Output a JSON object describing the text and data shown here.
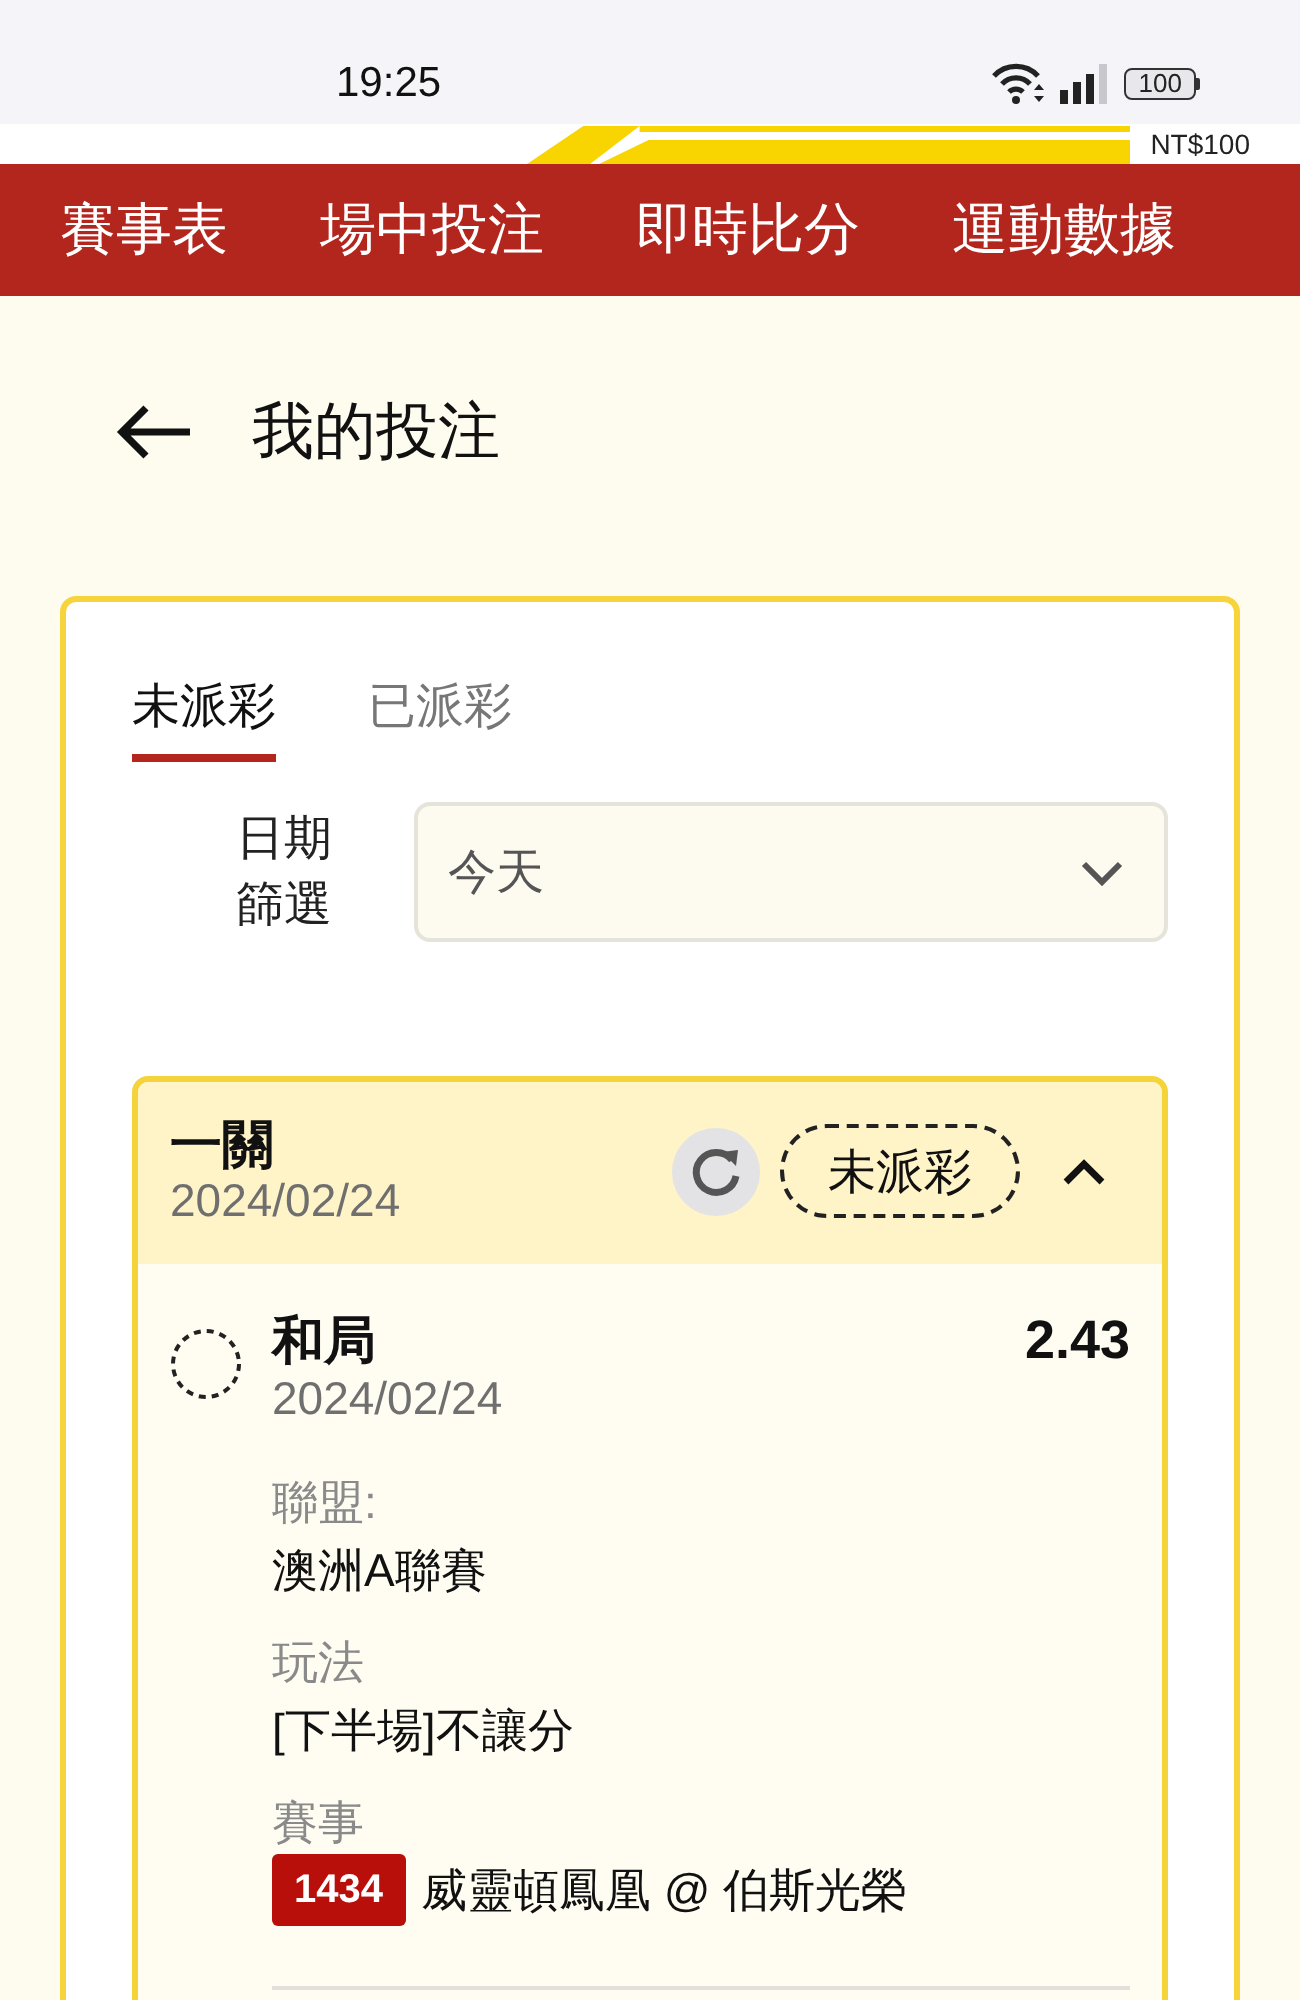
{
  "status_bar": {
    "time": "19:25",
    "battery": "100"
  },
  "balance": "NT$100",
  "nav": [
    "賽事表",
    "場中投注",
    "即時比分",
    "運動數據"
  ],
  "page": {
    "title": "我的投注"
  },
  "tabs": [
    {
      "label": "未派彩",
      "selected": true
    },
    {
      "label": "已派彩",
      "selected": false
    }
  ],
  "date_filter": {
    "label": "日期篩選",
    "value": "今天"
  },
  "bets": [
    {
      "type": "一關",
      "date": "2024/02/24",
      "status": "未派彩",
      "expanded": true,
      "legs": [
        {
          "selection": "和局",
          "odds": "2.43",
          "date": "2024/02/24",
          "fields": [
            {
              "label": "聯盟:",
              "value": "澳洲A聯賽"
            },
            {
              "label": "玩法",
              "value": "[下半場]不讓分"
            },
            {
              "label": "賽事",
              "match_no": "1434",
              "value": "威靈頓鳳凰 @ 伯斯光榮"
            }
          ]
        }
      ]
    }
  ]
}
